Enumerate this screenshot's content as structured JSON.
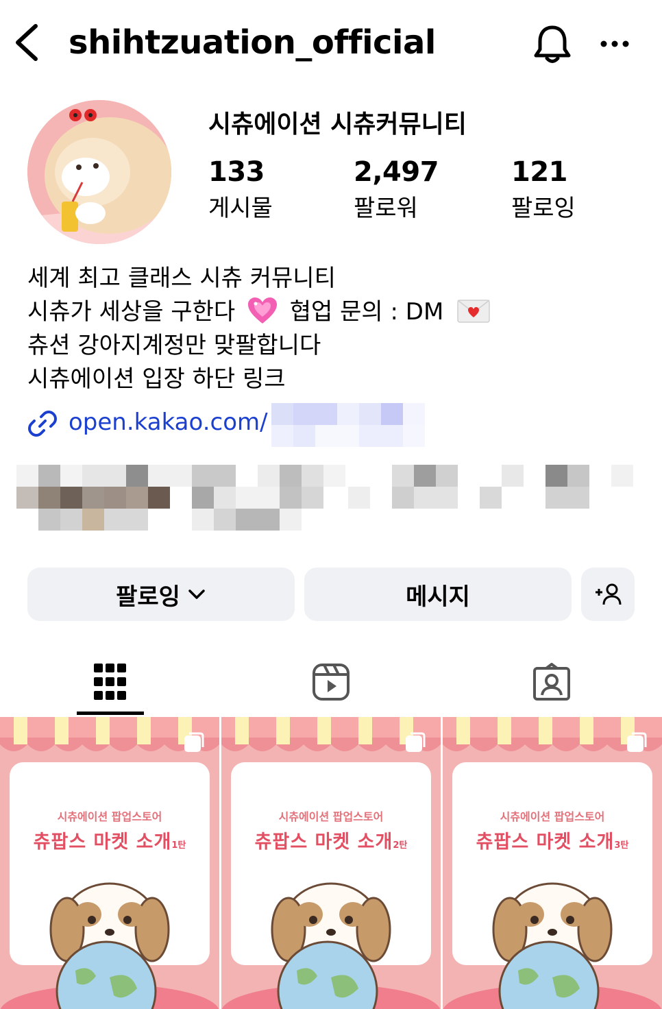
{
  "header": {
    "username": "shihtzuation_official",
    "icons": [
      "back-icon",
      "bell-icon",
      "more-icon"
    ]
  },
  "profile": {
    "display_name": "시츄에이션 시츄커뮤니티",
    "stats": [
      {
        "value": "133",
        "label": "게시물"
      },
      {
        "value": "2,497",
        "label": "팔로워"
      },
      {
        "value": "121",
        "label": "팔로잉"
      }
    ]
  },
  "bio": {
    "line1": "세계 최고 클래스 시츄 커뮤니티",
    "line2_a": "시츄가 세상을 구한다",
    "line2_b": "협업 문의 : DM",
    "line3": "츄션 강아지계정만 맞팔합니다",
    "line4": "시츄에이션 입장 하단 링크",
    "link": "open.kakao.com/"
  },
  "buttons": {
    "follow": "팔로잉",
    "message": "메시지"
  },
  "tabs": [
    "grid-icon",
    "reels-icon",
    "tagged-icon"
  ],
  "posts": [
    {
      "subtitle": "시츄에이션 팝업스토어",
      "title": "츄팝스 마켓 소개",
      "part": "1탄"
    },
    {
      "subtitle": "시츄에이션 팝업스토어",
      "title": "츄팝스 마켓 소개",
      "part": "2탄"
    },
    {
      "subtitle": "시츄에이션 팝업스토어",
      "title": "츄팝스 마켓 소개",
      "part": "3탄"
    }
  ],
  "colors": {
    "link": "#1b40cf",
    "button_bg": "#eff1f4",
    "post_bg": "#f4b3b3",
    "post_title": "#e24f62"
  }
}
